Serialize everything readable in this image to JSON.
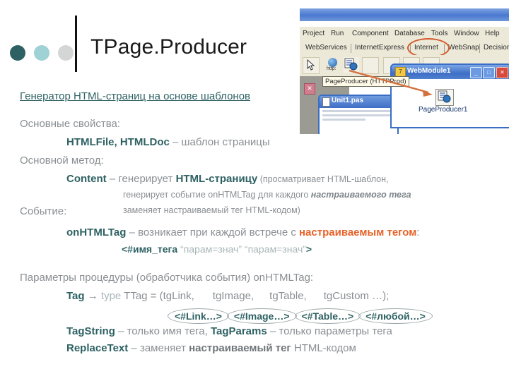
{
  "slide": {
    "title": "TPage.Producer",
    "header_dots": [
      "#2e6163",
      "#9ed2d4",
      "#d4d6d6"
    ],
    "subtitle": "Генератор HTML-страниц на основе шаблонов",
    "lines": {
      "props_label": "Основные свойства:",
      "props_names": "HTMLFile, HTMLDoc",
      "props_desc": " – шаблон страницы",
      "method_label": "Основной метод:",
      "method_name": "Content",
      "method_desc": " – генерирует ",
      "method_desc2": "HTML-страницу",
      "method_note1": " (просматривает HTML-шаблон,",
      "method_note2": "генерирует событие onHTMLTag для каждого ",
      "method_note2_em": "настраиваемого тега",
      "method_note3": "заменяет настраиваемый тег HTML-кодом)",
      "event_label": "Событие:",
      "event_name": "onHTMLTag",
      "event_desc": " – возникает при каждой встрече с ",
      "event_desc_em": "настраиваемым тегом",
      "event_desc_colon": ":",
      "tag_syntax_name": "<#имя_тега",
      "tag_syntax_params": " “парам=знач” “парам=знач”",
      "tag_syntax_close": ">",
      "params_label": "Параметры процедуры (обработчика события) onHTMLTag:",
      "tag_param": "Tag",
      "tag_arrow": " → ",
      "tag_type_kw": "type",
      "tag_type_decl": " TTag = (tgLink,",
      "tag_enum2": "tgImage,",
      "tag_enum3": "tgTable,",
      "tag_enum4": "tgCustom  …);",
      "tagstring": "TagString",
      "tagstring_desc": " – только имя тега,  ",
      "tagparams": "TagParams",
      "tagparams_desc": " – только параметры тега",
      "replacetext": "ReplaceText",
      "replacetext_desc": " – заменяет ",
      "replacetext_em": "настраиваемый тег",
      "replacetext_tail": " HTML-кодом"
    },
    "callouts": [
      "<#Link…>",
      "<#Image…>",
      "<#Table…>",
      "<#любой…>"
    ],
    "colors": {
      "teal": "#2e6163",
      "gray": "#8a8f93",
      "light_teal": "#a9b6b8",
      "orange": "#e8622a",
      "highlight_ring": "#d4582c"
    }
  },
  "screenshot": {
    "menu_items": [
      "Project",
      "Run",
      "Component",
      "Database",
      "Tools",
      "Window",
      "Help"
    ],
    "palette_tabs": [
      "WebServices",
      "InternetExpress",
      "Internet",
      "WebSnap",
      "Decision"
    ],
    "highlighted_tab": "Internet",
    "http_label": "http:",
    "tooltip": "PageProducer (HTTPProd)",
    "unit_window": {
      "title": "Unit1.pas"
    },
    "webmodule_window": {
      "title": "WebModule1",
      "minimize": "_",
      "maximize": "□",
      "close": "✕",
      "component_label": "PageProducer1"
    }
  }
}
